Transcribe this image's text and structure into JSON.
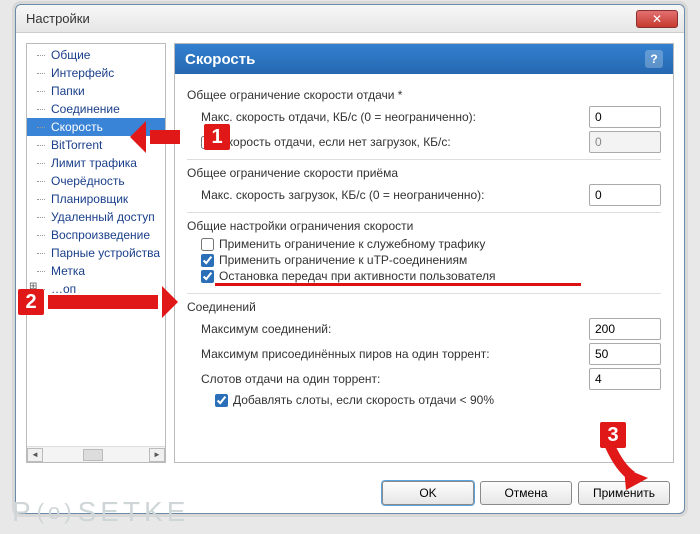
{
  "window": {
    "title": "Настройки"
  },
  "sidebar": {
    "items": [
      "Общие",
      "Интерфейс",
      "Папки",
      "Соединение",
      "Скорость",
      "BitTorrent",
      "Лимит трафика",
      "Очерёдность",
      "Планировщик",
      "Удаленный доступ",
      "Воспроизведение",
      "Парные устройства",
      "Метка",
      "…оп"
    ],
    "selectedIndex": 4
  },
  "panel": {
    "title": "Скорость",
    "upload": {
      "heading": "Общее ограничение скорости отдачи *",
      "maxLabel": "Макс. скорость отдачи, КБ/с (0 = неограниченно):",
      "maxValue": "0",
      "altLabel": "Скорость отдачи, если нет загрузок, КБ/с:",
      "altValue": "0",
      "altChecked": false
    },
    "download": {
      "heading": "Общее ограничение скорости приёма",
      "maxLabel": "Макс. скорость загрузок, КБ/с (0 = неограниченно):",
      "maxValue": "0"
    },
    "globalRate": {
      "heading": "Общие настройки ограничения скорости",
      "opt1": "Применить ограничение к служебному трафику",
      "opt1Checked": false,
      "opt2": "Применить ограничение к uTP-соединениям",
      "opt2Checked": true,
      "opt3": "Остановка передач при активности пользователя",
      "opt3Checked": true
    },
    "conn": {
      "heading": "Соединений",
      "maxConnLabel": "Максимум соединений:",
      "maxConnValue": "200",
      "maxPeersLabel": "Максимум присоединённых пиров на один торрент:",
      "maxPeersValue": "50",
      "slotsLabel": "Слотов отдачи на один торрент:",
      "slotsValue": "4",
      "addSlotsLabel": "Добавлять слоты, если скорость отдачи < 90%",
      "addSlotsChecked": true
    }
  },
  "buttons": {
    "ok": "OK",
    "cancel": "Отмена",
    "apply": "Применить"
  },
  "annotations": {
    "n1": "1",
    "n2": "2",
    "n3": "3"
  },
  "watermark": {
    "p": "P",
    "o": "(o)",
    "rest": "SETKE"
  }
}
